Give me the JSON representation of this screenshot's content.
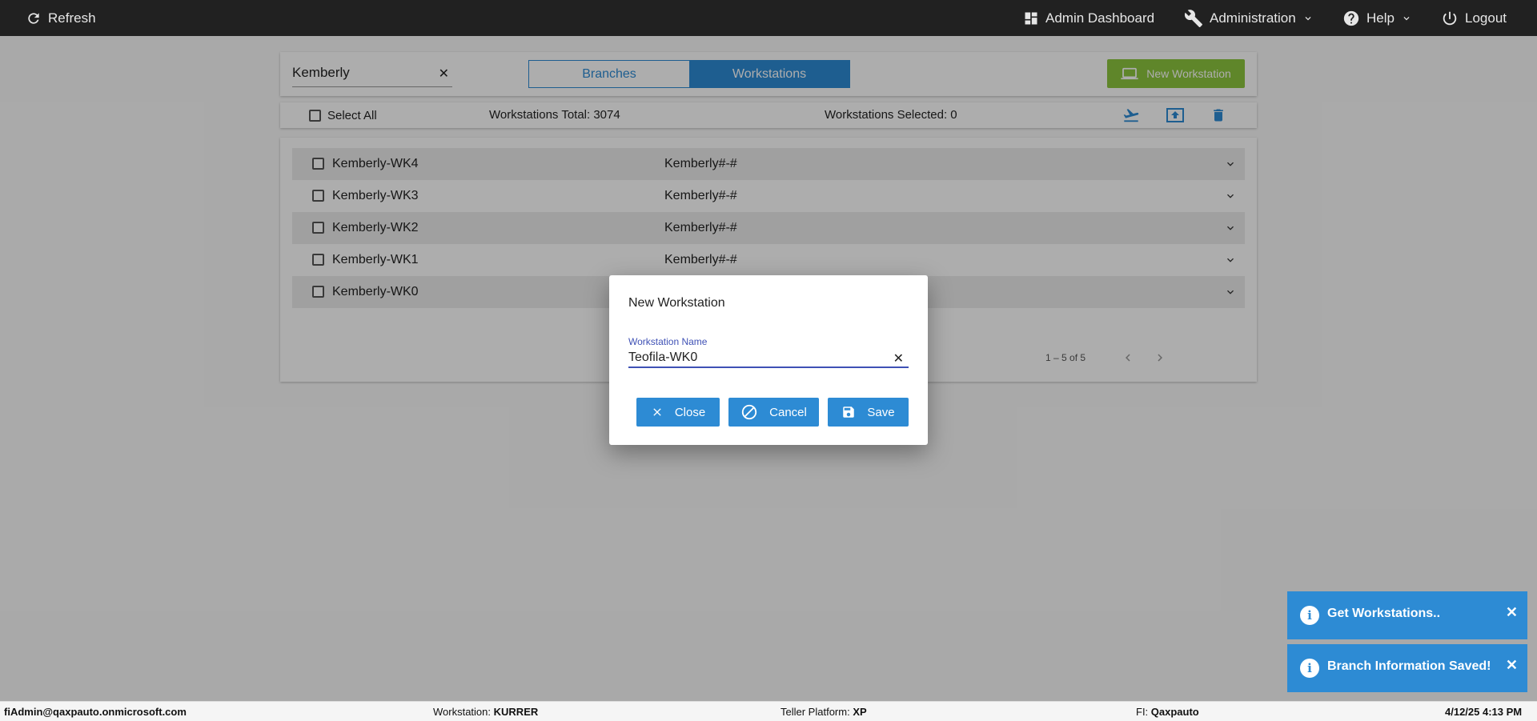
{
  "topbar": {
    "refresh_label": "Refresh",
    "admin_dashboard_label": "Admin Dashboard",
    "administration_label": "Administration",
    "help_label": "Help",
    "logout_label": "Logout"
  },
  "toolbar": {
    "search_value": "Kemberly",
    "tab_branches": "Branches",
    "tab_workstations": "Workstations",
    "active_tab": "Workstations",
    "new_workstation_label": "New Workstation"
  },
  "summary": {
    "select_all_label": "Select All",
    "total_label": "Workstations Total: 3074",
    "selected_label": "Workstations Selected: 0"
  },
  "rows": [
    {
      "name": "Kemberly-WK4",
      "code": "Kemberly#-#"
    },
    {
      "name": "Kemberly-WK3",
      "code": "Kemberly#-#"
    },
    {
      "name": "Kemberly-WK2",
      "code": "Kemberly#-#"
    },
    {
      "name": "Kemberly-WK1",
      "code": "Kemberly#-#"
    },
    {
      "name": "Kemberly-WK0",
      "code": ""
    }
  ],
  "pager": {
    "range_label": "1 – 5 of 5"
  },
  "dialog": {
    "title": "New Workstation",
    "field_label": "Workstation Name",
    "field_value": "Teofila-WK0",
    "close_label": "Close",
    "cancel_label": "Cancel",
    "save_label": "Save"
  },
  "toasts": [
    {
      "message": "Get Workstations.."
    },
    {
      "message": "Branch Information Saved!"
    }
  ],
  "footer": {
    "user": "fiAdmin@qaxpauto.onmicrosoft.com",
    "workstation_label": "Workstation:",
    "workstation_value": "KURRER",
    "platform_label": "Teller Platform:",
    "platform_value": "XP",
    "fi_label": "FI:",
    "fi_value": "Qaxpauto",
    "datetime": "4/12/25 4:13 PM"
  },
  "colors": {
    "primary": "#2d8bd4",
    "success": "#8dc63f",
    "topbar": "#212121",
    "focus": "#3f51b5"
  }
}
